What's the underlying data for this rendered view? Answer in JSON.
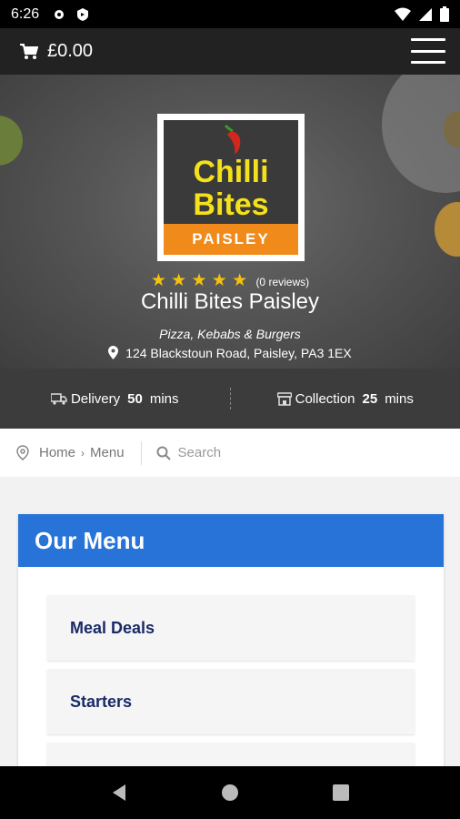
{
  "status_bar": {
    "time": "6:26"
  },
  "app_bar": {
    "cart_total": "£0.00"
  },
  "restaurant": {
    "name": "Chilli Bites Paisley",
    "logo_top": "Chilli",
    "logo_mid": "Bites",
    "logo_band": "PAISLEY",
    "rating_stars": 5,
    "reviews_text": "(0 reviews)",
    "cuisine": "Pizza, Kebabs & Burgers",
    "address": "124 Blackstoun Road, Paisley, PA3 1EX"
  },
  "info": {
    "delivery_label": "Delivery",
    "delivery_time": "50",
    "delivery_unit": "mins",
    "collection_label": "Collection",
    "collection_time": "25",
    "collection_unit": "mins"
  },
  "breadcrumb": {
    "home": "Home",
    "separator": "›",
    "current": "Menu"
  },
  "search": {
    "placeholder": "Search"
  },
  "menu": {
    "title": "Our Menu",
    "categories": [
      "Meal Deals",
      "Starters"
    ]
  },
  "colors": {
    "accent": "#2773d8",
    "star": "#f4c20d",
    "category_text": "#1a2a66"
  }
}
